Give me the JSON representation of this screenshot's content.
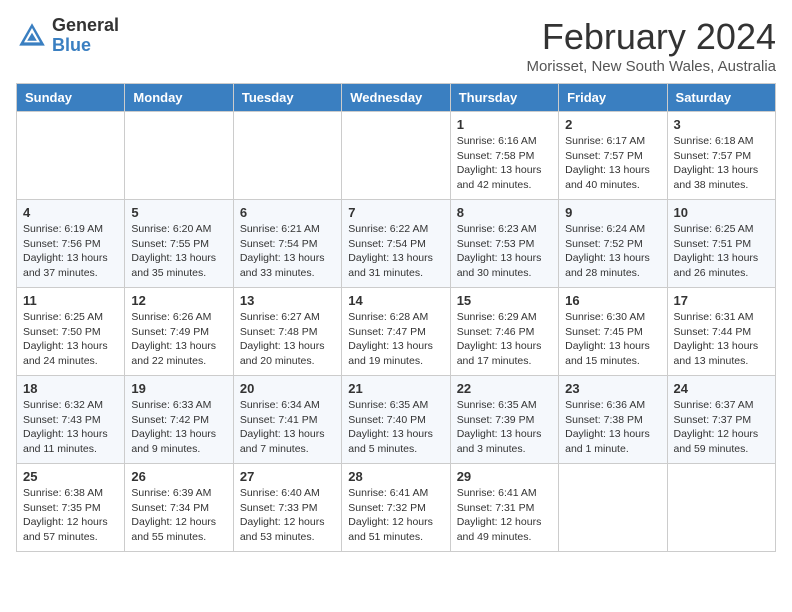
{
  "logo": {
    "general": "General",
    "blue": "Blue"
  },
  "title": "February 2024",
  "subtitle": "Morisset, New South Wales, Australia",
  "weekdays": [
    "Sunday",
    "Monday",
    "Tuesday",
    "Wednesday",
    "Thursday",
    "Friday",
    "Saturday"
  ],
  "weeks": [
    [
      {
        "day": "",
        "sunrise": "",
        "sunset": "",
        "daylight": ""
      },
      {
        "day": "",
        "sunrise": "",
        "sunset": "",
        "daylight": ""
      },
      {
        "day": "",
        "sunrise": "",
        "sunset": "",
        "daylight": ""
      },
      {
        "day": "",
        "sunrise": "",
        "sunset": "",
        "daylight": ""
      },
      {
        "day": "1",
        "sunrise": "Sunrise: 6:16 AM",
        "sunset": "Sunset: 7:58 PM",
        "daylight": "Daylight: 13 hours and 42 minutes."
      },
      {
        "day": "2",
        "sunrise": "Sunrise: 6:17 AM",
        "sunset": "Sunset: 7:57 PM",
        "daylight": "Daylight: 13 hours and 40 minutes."
      },
      {
        "day": "3",
        "sunrise": "Sunrise: 6:18 AM",
        "sunset": "Sunset: 7:57 PM",
        "daylight": "Daylight: 13 hours and 38 minutes."
      }
    ],
    [
      {
        "day": "4",
        "sunrise": "Sunrise: 6:19 AM",
        "sunset": "Sunset: 7:56 PM",
        "daylight": "Daylight: 13 hours and 37 minutes."
      },
      {
        "day": "5",
        "sunrise": "Sunrise: 6:20 AM",
        "sunset": "Sunset: 7:55 PM",
        "daylight": "Daylight: 13 hours and 35 minutes."
      },
      {
        "day": "6",
        "sunrise": "Sunrise: 6:21 AM",
        "sunset": "Sunset: 7:54 PM",
        "daylight": "Daylight: 13 hours and 33 minutes."
      },
      {
        "day": "7",
        "sunrise": "Sunrise: 6:22 AM",
        "sunset": "Sunset: 7:54 PM",
        "daylight": "Daylight: 13 hours and 31 minutes."
      },
      {
        "day": "8",
        "sunrise": "Sunrise: 6:23 AM",
        "sunset": "Sunset: 7:53 PM",
        "daylight": "Daylight: 13 hours and 30 minutes."
      },
      {
        "day": "9",
        "sunrise": "Sunrise: 6:24 AM",
        "sunset": "Sunset: 7:52 PM",
        "daylight": "Daylight: 13 hours and 28 minutes."
      },
      {
        "day": "10",
        "sunrise": "Sunrise: 6:25 AM",
        "sunset": "Sunset: 7:51 PM",
        "daylight": "Daylight: 13 hours and 26 minutes."
      }
    ],
    [
      {
        "day": "11",
        "sunrise": "Sunrise: 6:25 AM",
        "sunset": "Sunset: 7:50 PM",
        "daylight": "Daylight: 13 hours and 24 minutes."
      },
      {
        "day": "12",
        "sunrise": "Sunrise: 6:26 AM",
        "sunset": "Sunset: 7:49 PM",
        "daylight": "Daylight: 13 hours and 22 minutes."
      },
      {
        "day": "13",
        "sunrise": "Sunrise: 6:27 AM",
        "sunset": "Sunset: 7:48 PM",
        "daylight": "Daylight: 13 hours and 20 minutes."
      },
      {
        "day": "14",
        "sunrise": "Sunrise: 6:28 AM",
        "sunset": "Sunset: 7:47 PM",
        "daylight": "Daylight: 13 hours and 19 minutes."
      },
      {
        "day": "15",
        "sunrise": "Sunrise: 6:29 AM",
        "sunset": "Sunset: 7:46 PM",
        "daylight": "Daylight: 13 hours and 17 minutes."
      },
      {
        "day": "16",
        "sunrise": "Sunrise: 6:30 AM",
        "sunset": "Sunset: 7:45 PM",
        "daylight": "Daylight: 13 hours and 15 minutes."
      },
      {
        "day": "17",
        "sunrise": "Sunrise: 6:31 AM",
        "sunset": "Sunset: 7:44 PM",
        "daylight": "Daylight: 13 hours and 13 minutes."
      }
    ],
    [
      {
        "day": "18",
        "sunrise": "Sunrise: 6:32 AM",
        "sunset": "Sunset: 7:43 PM",
        "daylight": "Daylight: 13 hours and 11 minutes."
      },
      {
        "day": "19",
        "sunrise": "Sunrise: 6:33 AM",
        "sunset": "Sunset: 7:42 PM",
        "daylight": "Daylight: 13 hours and 9 minutes."
      },
      {
        "day": "20",
        "sunrise": "Sunrise: 6:34 AM",
        "sunset": "Sunset: 7:41 PM",
        "daylight": "Daylight: 13 hours and 7 minutes."
      },
      {
        "day": "21",
        "sunrise": "Sunrise: 6:35 AM",
        "sunset": "Sunset: 7:40 PM",
        "daylight": "Daylight: 13 hours and 5 minutes."
      },
      {
        "day": "22",
        "sunrise": "Sunrise: 6:35 AM",
        "sunset": "Sunset: 7:39 PM",
        "daylight": "Daylight: 13 hours and 3 minutes."
      },
      {
        "day": "23",
        "sunrise": "Sunrise: 6:36 AM",
        "sunset": "Sunset: 7:38 PM",
        "daylight": "Daylight: 13 hours and 1 minute."
      },
      {
        "day": "24",
        "sunrise": "Sunrise: 6:37 AM",
        "sunset": "Sunset: 7:37 PM",
        "daylight": "Daylight: 12 hours and 59 minutes."
      }
    ],
    [
      {
        "day": "25",
        "sunrise": "Sunrise: 6:38 AM",
        "sunset": "Sunset: 7:35 PM",
        "daylight": "Daylight: 12 hours and 57 minutes."
      },
      {
        "day": "26",
        "sunrise": "Sunrise: 6:39 AM",
        "sunset": "Sunset: 7:34 PM",
        "daylight": "Daylight: 12 hours and 55 minutes."
      },
      {
        "day": "27",
        "sunrise": "Sunrise: 6:40 AM",
        "sunset": "Sunset: 7:33 PM",
        "daylight": "Daylight: 12 hours and 53 minutes."
      },
      {
        "day": "28",
        "sunrise": "Sunrise: 6:41 AM",
        "sunset": "Sunset: 7:32 PM",
        "daylight": "Daylight: 12 hours and 51 minutes."
      },
      {
        "day": "29",
        "sunrise": "Sunrise: 6:41 AM",
        "sunset": "Sunset: 7:31 PM",
        "daylight": "Daylight: 12 hours and 49 minutes."
      },
      {
        "day": "",
        "sunrise": "",
        "sunset": "",
        "daylight": ""
      },
      {
        "day": "",
        "sunrise": "",
        "sunset": "",
        "daylight": ""
      }
    ]
  ]
}
